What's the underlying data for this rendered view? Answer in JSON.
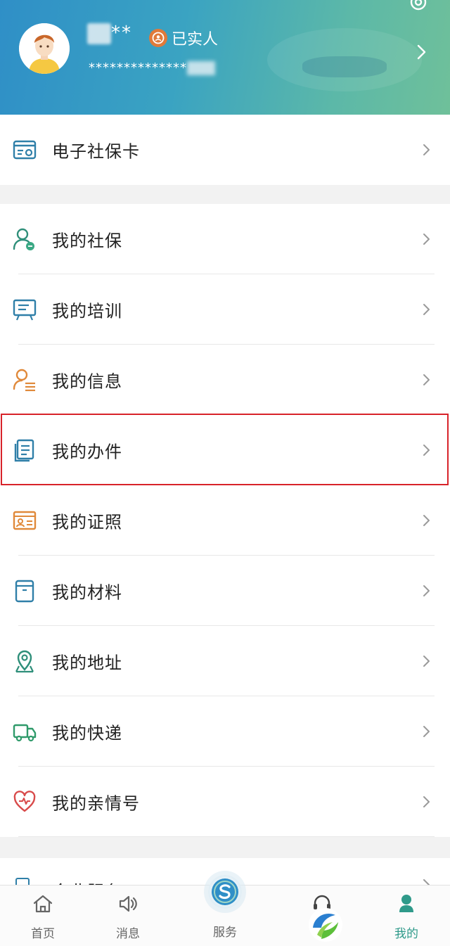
{
  "header": {
    "user_name_suffix": "**",
    "verified_label": "已实人",
    "masked_id": "**************"
  },
  "card_group": {
    "items": [
      {
        "label": "电子社保卡",
        "icon": "social-security-card-icon"
      }
    ]
  },
  "menu": {
    "items": [
      {
        "label": "我的社保",
        "icon": "user-security-icon"
      },
      {
        "label": "我的培训",
        "icon": "training-board-icon"
      },
      {
        "label": "我的信息",
        "icon": "user-info-icon"
      },
      {
        "label": "我的办件",
        "icon": "documents-icon",
        "highlighted": true
      },
      {
        "label": "我的证照",
        "icon": "id-card-icon"
      },
      {
        "label": "我的材料",
        "icon": "folder-icon"
      },
      {
        "label": "我的地址",
        "icon": "location-pin-icon"
      },
      {
        "label": "我的快递",
        "icon": "delivery-truck-icon"
      },
      {
        "label": "我的亲情号",
        "icon": "heart-icon"
      }
    ]
  },
  "partial_item": {
    "label": "企业服务",
    "icon": "enterprise-icon"
  },
  "tabbar": {
    "tabs": [
      {
        "label": "首页",
        "icon": "home-icon"
      },
      {
        "label": "消息",
        "icon": "speaker-icon"
      },
      {
        "label": "服务",
        "icon": "service-logo-icon"
      },
      {
        "label": "",
        "icon": "customer-service-icon"
      },
      {
        "label": "我的",
        "icon": "profile-icon",
        "active": true
      }
    ]
  },
  "colors": {
    "header_start": "#2f8fc7",
    "header_end": "#6fc09a",
    "highlight_border": "#d8232a",
    "active_tab": "#2f9a8a",
    "verified_badge": "#e07a3a"
  }
}
